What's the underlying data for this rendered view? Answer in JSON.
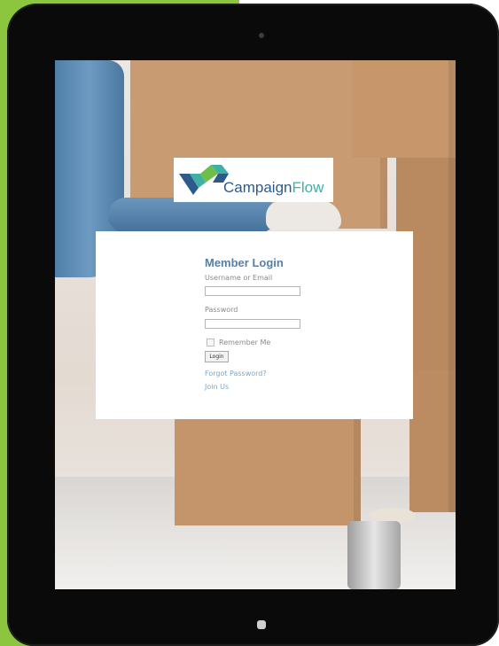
{
  "brand": {
    "logo_prefix": "Campaign",
    "logo_suffix": "Flow",
    "colors": {
      "green": "#8cc63f",
      "navy": "#2e5a8a",
      "teal": "#3fb0a3"
    }
  },
  "login": {
    "title": "Member Login",
    "username_label": "Username or Email",
    "username_value": "",
    "password_label": "Password",
    "password_value": "",
    "remember_label": "Remember Me",
    "remember_checked": false,
    "login_button": "Login",
    "forgot_link": "Forgot Password?",
    "join_link": "Join Us"
  },
  "device": {
    "camera_icon": "camera-dot",
    "home_icon": "home-button"
  }
}
